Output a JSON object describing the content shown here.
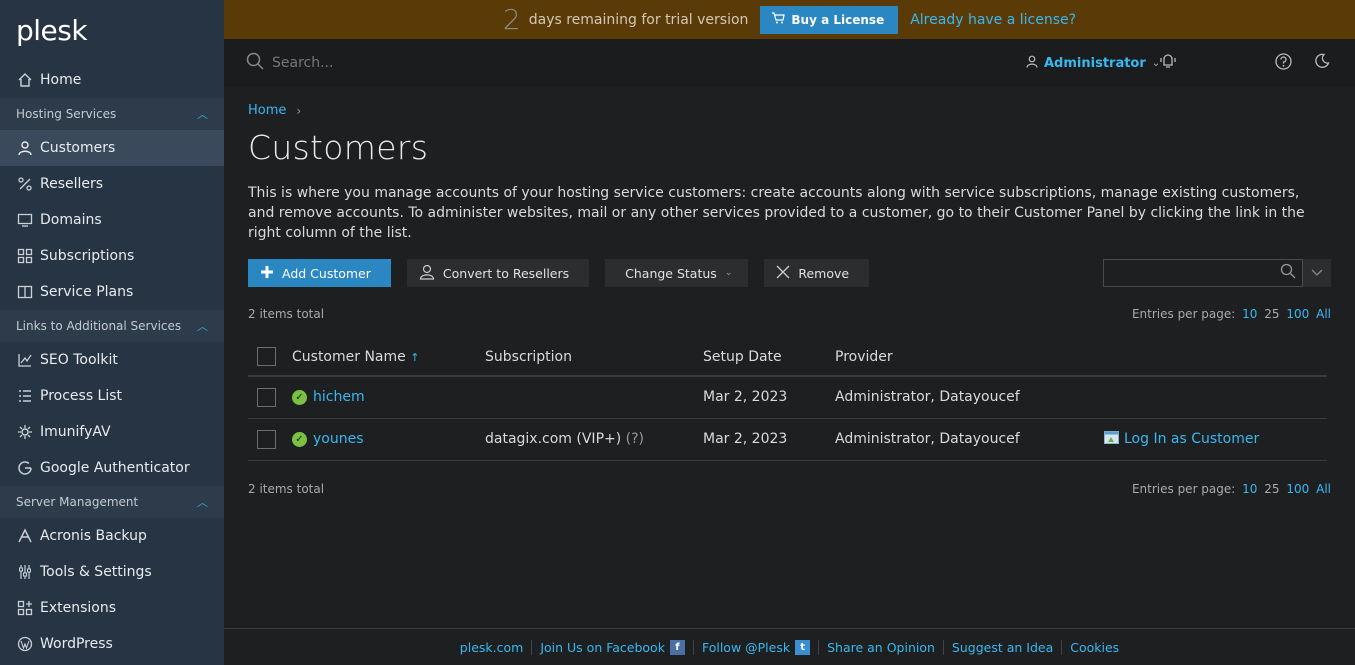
{
  "brand": "plesk",
  "banner": {
    "days": "2",
    "text": "days remaining for trial version",
    "buy_label": "Buy a License",
    "have_license": "Already have a license?"
  },
  "search": {
    "placeholder": "Search..."
  },
  "user": {
    "name": "Administrator"
  },
  "sidebar": {
    "home": "Home",
    "hosting_section": "Hosting Services",
    "hosting_items": [
      "Customers",
      "Resellers",
      "Domains",
      "Subscriptions",
      "Service Plans"
    ],
    "links_section": "Links to Additional Services",
    "links_items": [
      "SEO Toolkit",
      "Process List",
      "ImunifyAV",
      "Google Authenticator"
    ],
    "server_section": "Server Management",
    "server_items": [
      "Acronis Backup",
      "Tools & Settings",
      "Extensions",
      "WordPress"
    ]
  },
  "breadcrumb": {
    "home": "Home"
  },
  "page": {
    "title": "Customers",
    "description": "This is where you manage accounts of your hosting service customers: create accounts along with service subscriptions, manage existing customers, and remove accounts. To administer websites, mail or any other services provided to a customer, go to their Customer Panel by clicking the link in the right column of the list."
  },
  "toolbar": {
    "add": "Add Customer",
    "convert": "Convert to Resellers",
    "status": "Change Status",
    "remove": "Remove"
  },
  "list": {
    "total": "2 items total",
    "entries_label": "Entries per page:",
    "per_page": [
      "10",
      "25",
      "100",
      "All"
    ],
    "headers": {
      "name": "Customer Name",
      "subscription": "Subscription",
      "date": "Setup Date",
      "provider": "Provider"
    },
    "rows": [
      {
        "name": "hichem",
        "subscription": "",
        "date": "Mar 2, 2023",
        "provider": "Administrator, Datayoucef",
        "action": ""
      },
      {
        "name": "younes",
        "subscription": "datagix.com (VIP+)",
        "help": "(?)",
        "date": "Mar 2, 2023",
        "provider": "Administrator, Datayoucef",
        "action": "Log In as Customer"
      }
    ]
  },
  "footer": [
    "plesk.com",
    "Join Us on Facebook",
    "Follow @Plesk",
    "Share an Opinion",
    "Suggest an Idea",
    "Cookies"
  ]
}
